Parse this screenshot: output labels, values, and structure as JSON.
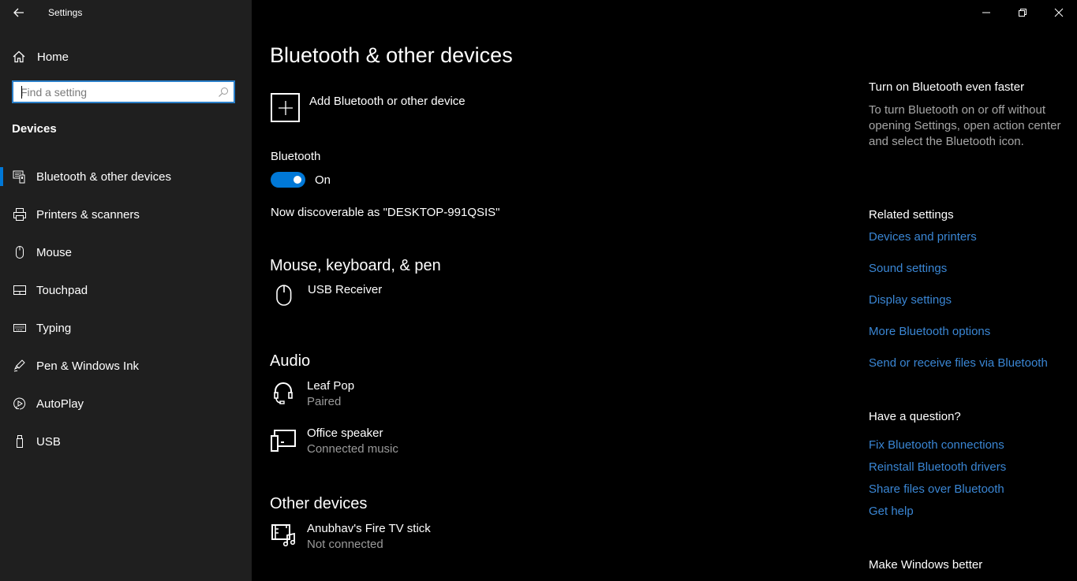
{
  "window": {
    "app_title": "Settings",
    "controls": [
      "minimize",
      "restore",
      "close"
    ]
  },
  "sidebar": {
    "home_label": "Home",
    "search": {
      "placeholder": "Find a setting",
      "value": ""
    },
    "section_title": "Devices",
    "items": [
      {
        "label": "Bluetooth & other devices",
        "icon": "bluetooth-devices-icon",
        "selected": true
      },
      {
        "label": "Printers & scanners",
        "icon": "printer-icon",
        "selected": false
      },
      {
        "label": "Mouse",
        "icon": "mouse-icon",
        "selected": false
      },
      {
        "label": "Touchpad",
        "icon": "touchpad-icon",
        "selected": false
      },
      {
        "label": "Typing",
        "icon": "keyboard-icon",
        "selected": false
      },
      {
        "label": "Pen & Windows Ink",
        "icon": "pen-icon",
        "selected": false
      },
      {
        "label": "AutoPlay",
        "icon": "autoplay-icon",
        "selected": false
      },
      {
        "label": "USB",
        "icon": "usb-icon",
        "selected": false
      }
    ]
  },
  "main": {
    "title": "Bluetooth & other devices",
    "add_device_label": "Add Bluetooth or other device",
    "bluetooth_label": "Bluetooth",
    "bluetooth_toggle": {
      "on": true,
      "state_label": "On"
    },
    "discoverable_text": "Now discoverable as \"DESKTOP-991QSIS\"",
    "groups": [
      {
        "title": "Mouse, keyboard, & pen",
        "devices": [
          {
            "name": "USB Receiver",
            "status": "",
            "icon": "mouse-icon"
          }
        ]
      },
      {
        "title": "Audio",
        "devices": [
          {
            "name": "Leaf Pop",
            "status": "Paired",
            "icon": "headset-icon"
          },
          {
            "name": "Office speaker",
            "status": "Connected music",
            "icon": "media-device-icon"
          }
        ]
      },
      {
        "title": "Other devices",
        "devices": [
          {
            "name": "Anubhav's Fire TV stick",
            "status": "Not connected",
            "icon": "media-player-icon"
          }
        ]
      }
    ]
  },
  "aside": {
    "tip_title": "Turn on Bluetooth even faster",
    "tip_text": "To turn Bluetooth on or off without opening Settings, open action center and select the Bluetooth icon.",
    "related_title": "Related settings",
    "related_links": [
      "Devices and printers",
      "Sound settings",
      "Display settings",
      "More Bluetooth options",
      "Send or receive files via Bluetooth"
    ],
    "question_title": "Have a question?",
    "question_links": [
      "Fix Bluetooth connections",
      "Reinstall Bluetooth drivers",
      "Share files over Bluetooth",
      "Get help"
    ],
    "feedback_title": "Make Windows better"
  },
  "colors": {
    "accent": "#0078d7",
    "link": "#3a86d4",
    "sidebar_bg": "#1f1f1f",
    "main_bg": "#000000"
  }
}
